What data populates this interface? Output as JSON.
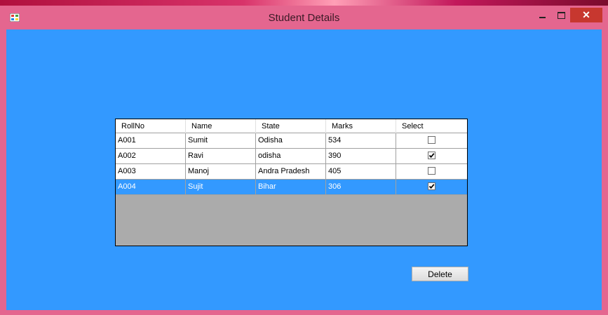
{
  "window": {
    "title": "Student Details"
  },
  "grid": {
    "columns": [
      "RollNo",
      "Name",
      "State",
      "Marks",
      "Select"
    ],
    "rows": [
      {
        "rollno": "A001",
        "name": "Sumit",
        "state": "Odisha",
        "marks": "534",
        "select": false,
        "selected": false
      },
      {
        "rollno": "A002",
        "name": "Ravi",
        "state": "odisha",
        "marks": "390",
        "select": true,
        "selected": false
      },
      {
        "rollno": "A003",
        "name": "Manoj",
        "state": "Andra Pradesh",
        "marks": "405",
        "select": false,
        "selected": false
      },
      {
        "rollno": "A004",
        "name": "Sujit",
        "state": "Bihar",
        "marks": "306",
        "select": true,
        "selected": true
      }
    ]
  },
  "actions": {
    "delete_label": "Delete"
  },
  "colors": {
    "client_background": "#3399ff",
    "titlebar": "#e4668f",
    "close_button": "#c7372f",
    "grid_empty_area": "#ababab",
    "selected_row": "#3399ff"
  },
  "icons": {
    "app": "app-icon",
    "minimize": "minimize-icon",
    "maximize": "maximize-icon",
    "close": "close-icon",
    "checkbox": "checkbox-icon"
  }
}
